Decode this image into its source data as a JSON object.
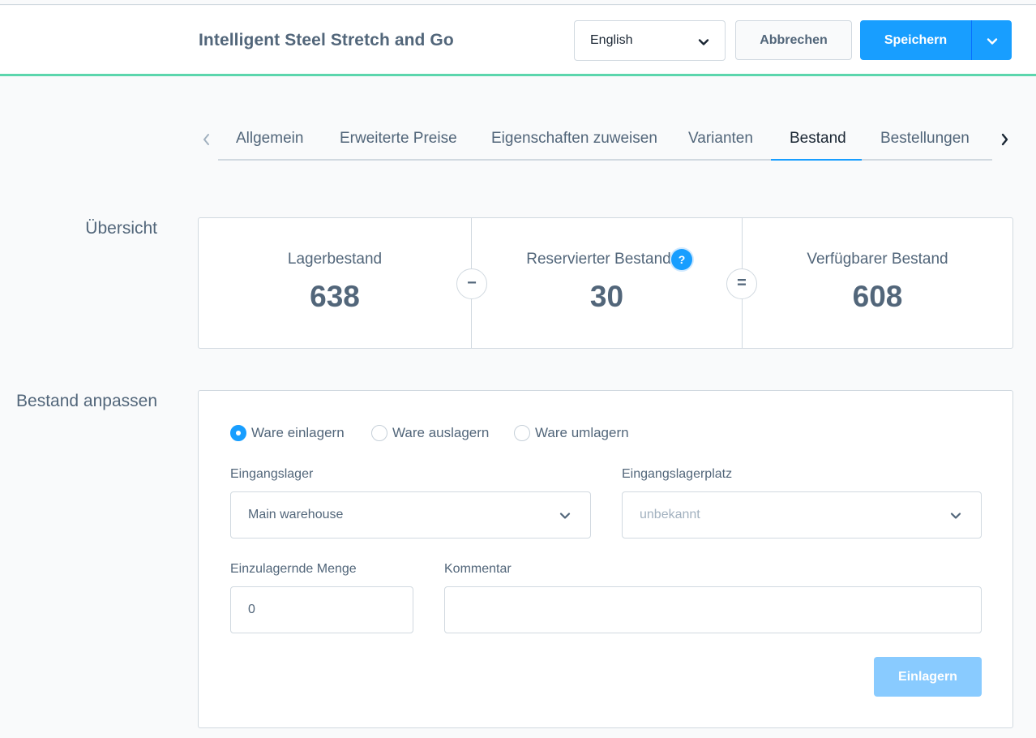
{
  "header": {
    "title": "Intelligent Steel Stretch and Go",
    "language_select": {
      "value": "English"
    },
    "cancel_label": "Abbrechen",
    "save_label": "Speichern"
  },
  "tabs": {
    "items": [
      {
        "label": "Allgemein"
      },
      {
        "label": "Erweiterte Preise"
      },
      {
        "label": "Eigenschaften zuweisen"
      },
      {
        "label": "Varianten"
      },
      {
        "label": "Bestand",
        "active": true
      },
      {
        "label": "Bestellungen"
      }
    ],
    "prev_icon": "chevron-left-icon",
    "next_icon": "chevron-right-icon"
  },
  "overview": {
    "section_label": "Übersicht",
    "stock": {
      "label": "Lagerbestand",
      "value": "638"
    },
    "minus_symbol": "−",
    "reserved": {
      "label": "Reservierter Bestand",
      "value": "30",
      "help_icon": "question-icon",
      "help_symbol": "?"
    },
    "equals_symbol": "=",
    "available": {
      "label": "Verfügbarer Bestand",
      "value": "608"
    }
  },
  "adjust": {
    "section_label": "Bestand anpassen",
    "radios": [
      {
        "label": "Ware einlagern",
        "checked": true
      },
      {
        "label": "Ware auslagern",
        "checked": false
      },
      {
        "label": "Ware umlagern",
        "checked": false
      }
    ],
    "warehouse": {
      "label": "Eingangslager",
      "value": "Main warehouse"
    },
    "bin": {
      "label": "Eingangslagerplatz",
      "placeholder": "unbekannt"
    },
    "quantity": {
      "label": "Einzulagernde Menge",
      "value": "0"
    },
    "comment": {
      "label": "Kommentar",
      "value": ""
    },
    "submit_label": "Einlagern"
  },
  "colors": {
    "primary": "#189eff",
    "primary_disabled": "#89cbff",
    "header_accent": "#5cd6ad",
    "text": "#52667a",
    "border": "#d1d9e0"
  }
}
